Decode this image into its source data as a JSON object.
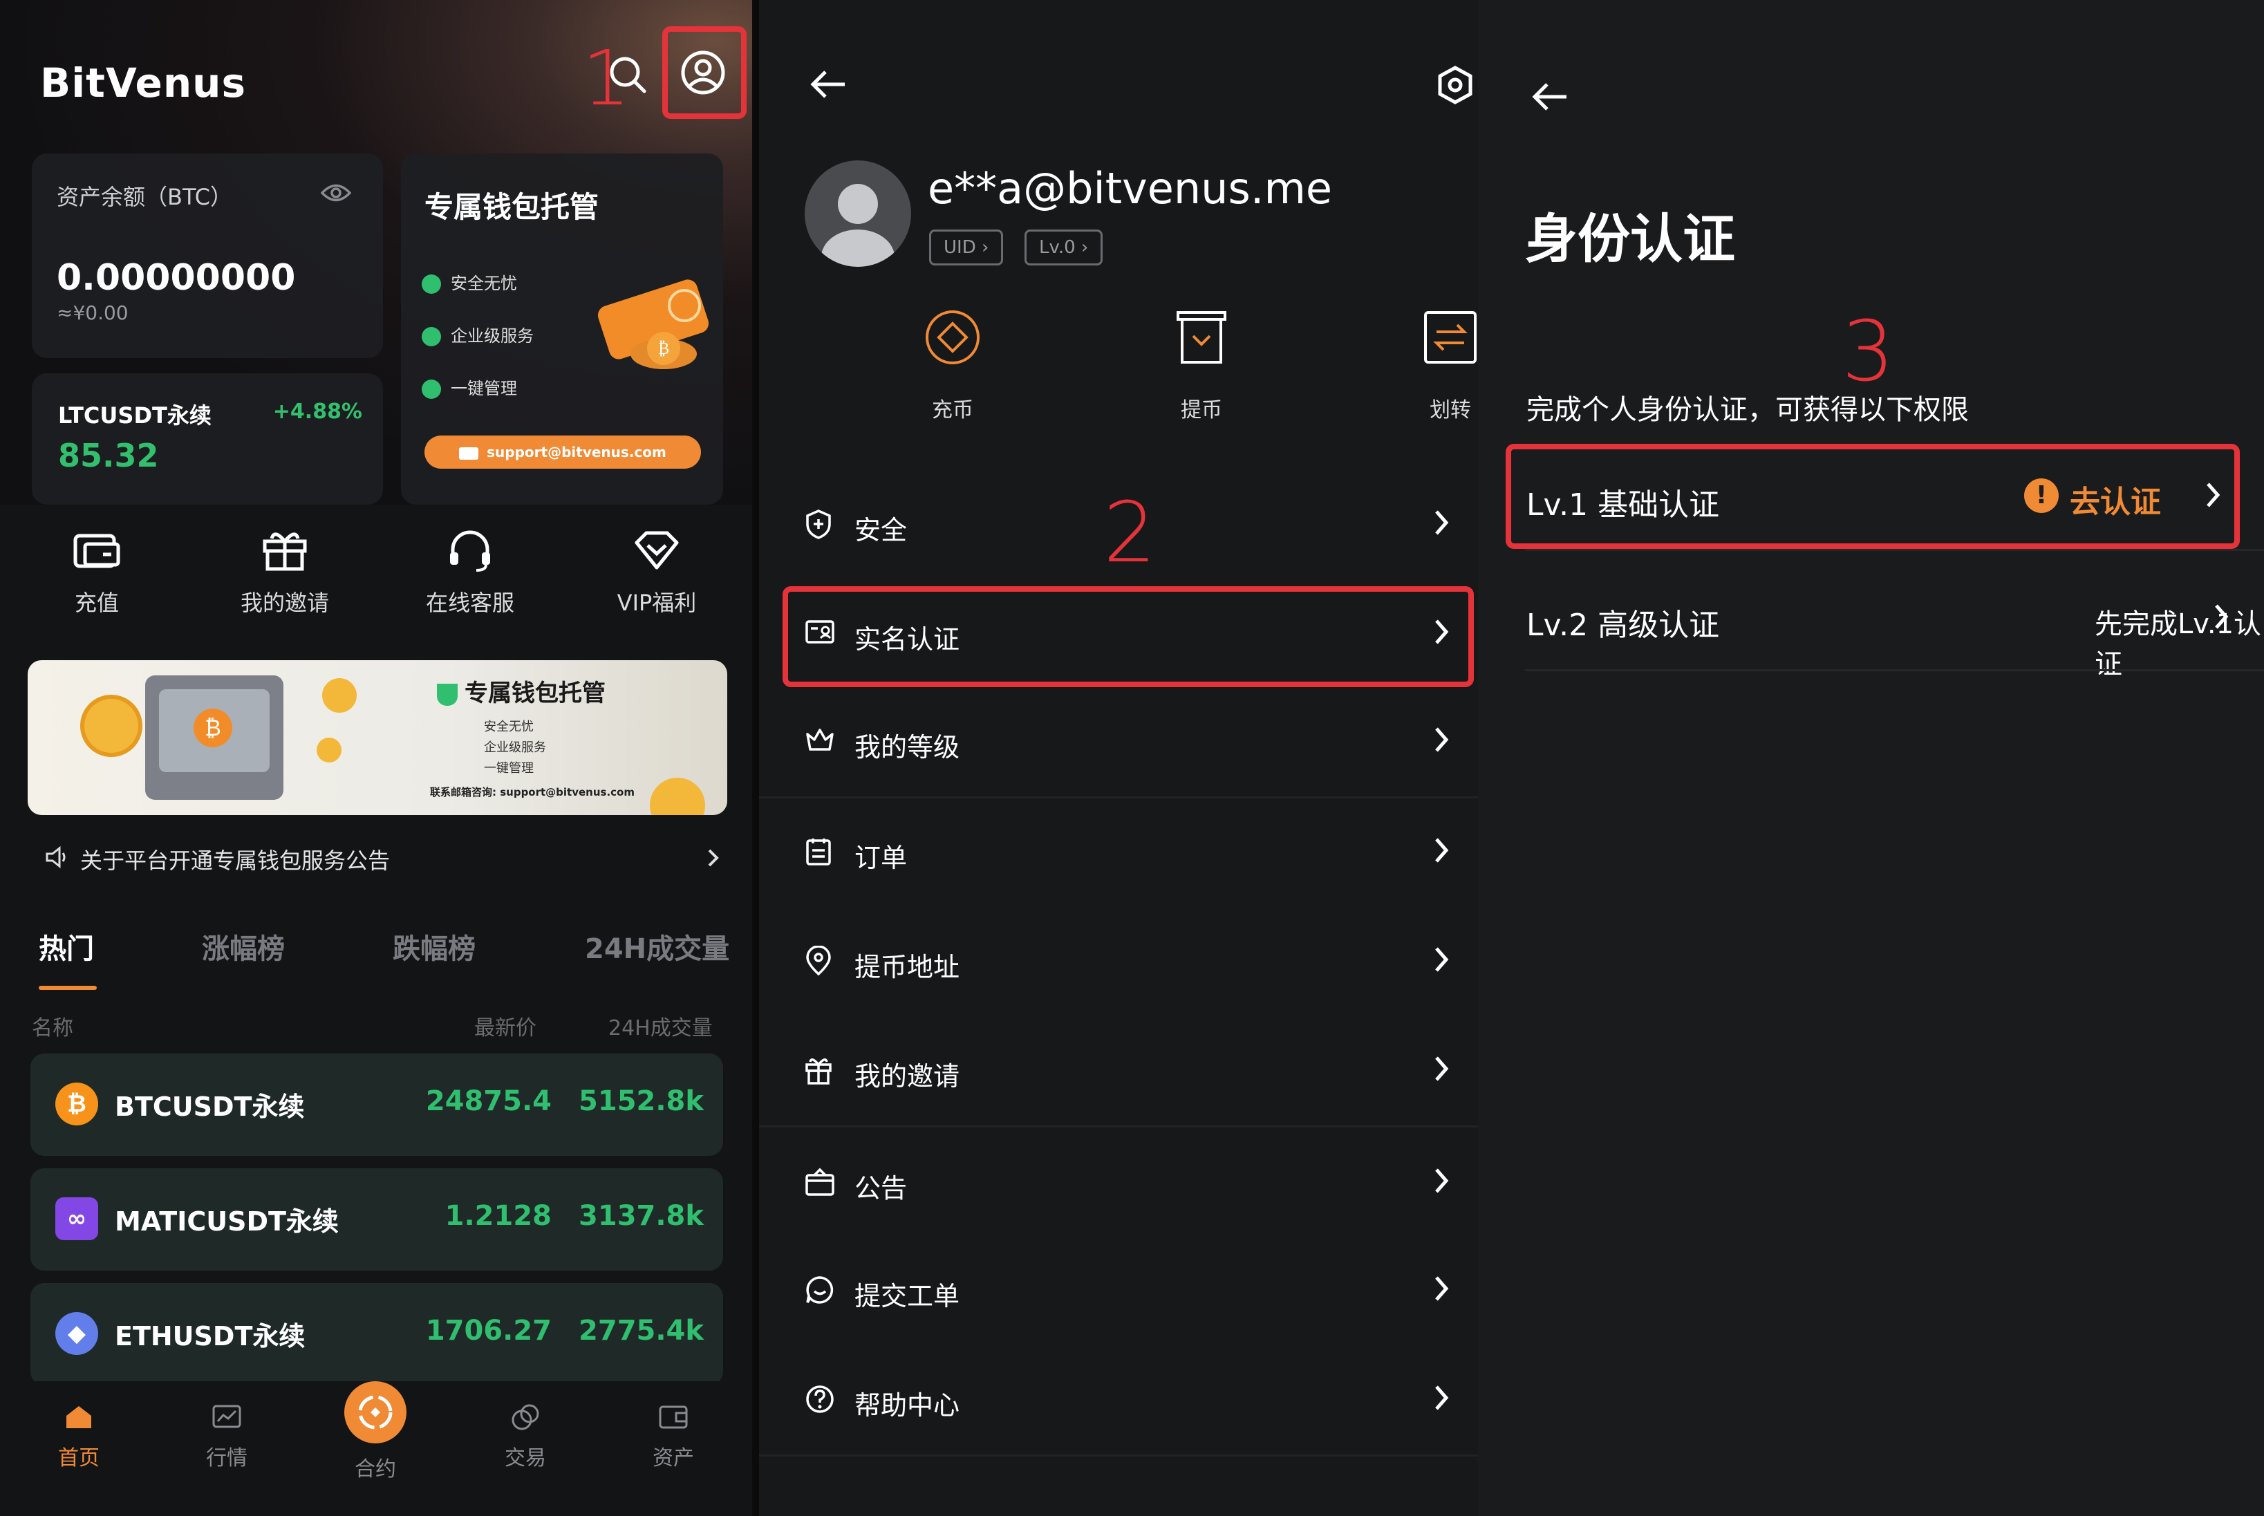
{
  "annotations": {
    "step1": "1",
    "step2": "2",
    "step3": "3"
  },
  "home": {
    "brand": "BitVenus",
    "asset": {
      "label": "资产余额（BTC）",
      "value": "0.00000000",
      "cny": "≈¥0.00"
    },
    "wallet_card": {
      "title": "专属钱包托管",
      "features": [
        "安全无忧",
        "企业级服务",
        "一键管理"
      ],
      "email": "support@bitvenus.com"
    },
    "ticker": {
      "name": "LTCUSDT永续",
      "change": "+4.88%",
      "price": "85.32"
    },
    "quick_actions": [
      {
        "label": "充值",
        "icon": "deposit-icon"
      },
      {
        "label": "我的邀请",
        "icon": "gift-icon"
      },
      {
        "label": "在线客服",
        "icon": "headset-icon"
      },
      {
        "label": "VIP福利",
        "icon": "diamond-icon"
      }
    ],
    "banner": {
      "title": "专属钱包托管",
      "features": [
        "安全无忧",
        "企业级服务",
        "一键管理"
      ],
      "contact": "联系邮箱咨询: support@bitvenus.com"
    },
    "notice": "关于平台开通专属钱包服务公告",
    "tabs": [
      "热门",
      "涨幅榜",
      "跌幅榜",
      "24H成交量"
    ],
    "columns": {
      "name": "名称",
      "price": "最新价",
      "volume": "24H成交量"
    },
    "markets": [
      {
        "name": "BTCUSDT永续",
        "price": "24875.4",
        "volume": "5152.8k",
        "icon": "bitcoin-icon",
        "color": "#f7931a"
      },
      {
        "name": "MATICUSDT永续",
        "price": "1.2128",
        "volume": "3137.8k",
        "icon": "polygon-icon",
        "color": "#8247e5"
      },
      {
        "name": "ETHUSDT永续",
        "price": "1706.27",
        "volume": "2775.4k",
        "icon": "ethereum-icon",
        "color": "#627eea"
      }
    ],
    "bottom_nav": [
      "首页",
      "行情",
      "合约",
      "交易",
      "资产"
    ]
  },
  "profile": {
    "email": "e**a@bitvenus.me",
    "uid_label": "UID",
    "level_label": "Lv.0",
    "actions": [
      "充币",
      "提币",
      "划转"
    ],
    "menu": [
      "安全",
      "实名认证",
      "我的等级",
      "订单",
      "提币地址",
      "我的邀请",
      "公告",
      "提交工单",
      "帮助中心"
    ]
  },
  "kyc": {
    "title": "身份认证",
    "subtitle": "完成个人身份认证，可获得以下权限",
    "lv1": {
      "label": "Lv.1 基础认证",
      "action": "去认证"
    },
    "lv2": {
      "label": "Lv.2 高级认证",
      "action": "先完成Lv.1认证"
    }
  },
  "colors": {
    "accent": "#f08a34",
    "highlight": "#e5333a",
    "up": "#2fbf6f"
  }
}
